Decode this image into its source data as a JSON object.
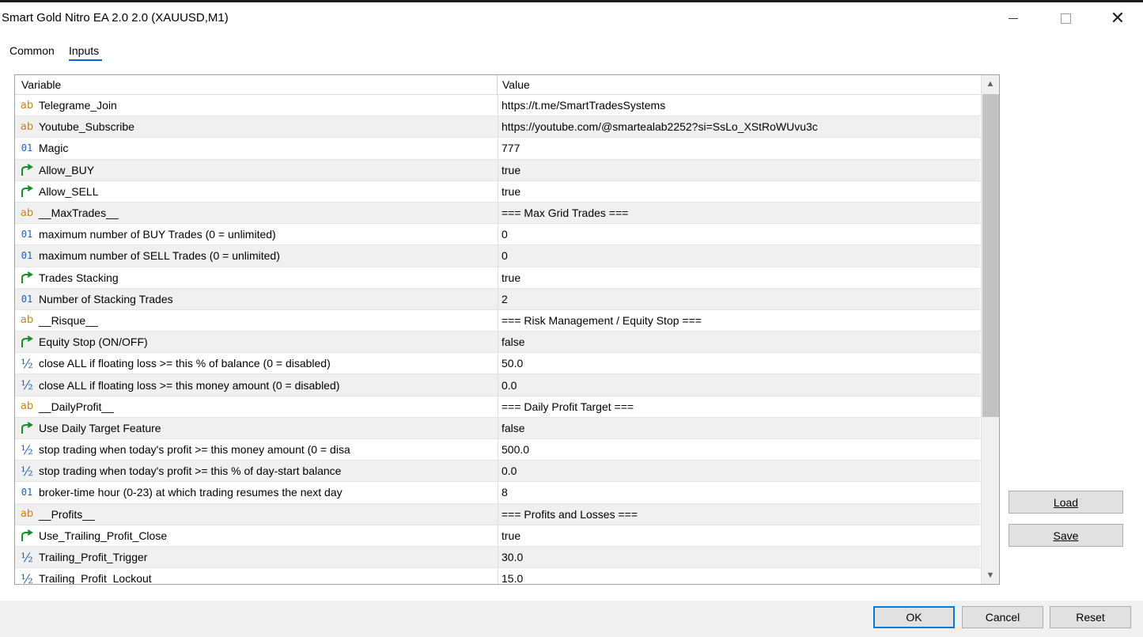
{
  "window": {
    "title": "Smart Gold Nitro EA 2.0 2.0 (XAUUSD,M1)"
  },
  "tabs": [
    {
      "label": "Common",
      "active": false
    },
    {
      "label": "Inputs",
      "active": true
    }
  ],
  "grid": {
    "headers": {
      "variable": "Variable",
      "value": "Value"
    },
    "rows": [
      {
        "type": "string",
        "icon_text": "ab",
        "variable": "Telegrame_Join",
        "value": "https://t.me/SmartTradesSystems"
      },
      {
        "type": "string",
        "icon_text": "ab",
        "variable": "Youtube_Subscribe",
        "value": "https://youtube.com/@smartealab2252?si=SsLo_XStRoWUvu3c"
      },
      {
        "type": "int",
        "icon_text": "01",
        "variable": "Magic",
        "value": "777"
      },
      {
        "type": "bool",
        "icon_text": "",
        "variable": "Allow_BUY",
        "value": "true"
      },
      {
        "type": "bool",
        "icon_text": "",
        "variable": "Allow_SELL",
        "value": "true"
      },
      {
        "type": "string",
        "icon_text": "ab",
        "variable": "__MaxTrades__",
        "value": "=== Max Grid Trades ==="
      },
      {
        "type": "int",
        "icon_text": "01",
        "variable": "maximum number of BUY Trades (0 = unlimited)",
        "value": "0"
      },
      {
        "type": "int",
        "icon_text": "01",
        "variable": "maximum number of SELL Trades  (0 = unlimited)",
        "value": "0"
      },
      {
        "type": "bool",
        "icon_text": "",
        "variable": "Trades Stacking",
        "value": "true"
      },
      {
        "type": "int",
        "icon_text": "01",
        "variable": "Number of Stacking Trades",
        "value": "2"
      },
      {
        "type": "string",
        "icon_text": "ab",
        "variable": "__Risque__",
        "value": "=== Risk Management / Equity Stop ==="
      },
      {
        "type": "bool",
        "icon_text": "",
        "variable": "Equity Stop (ON/OFF)",
        "value": "false"
      },
      {
        "type": "double",
        "icon_text": "½",
        "variable": "close ALL if floating loss >= this % of balance (0 = disabled)",
        "value": "50.0"
      },
      {
        "type": "double",
        "icon_text": "½",
        "variable": "close ALL  if floating loss >= this money amount (0 = disabled)",
        "value": "0.0"
      },
      {
        "type": "string",
        "icon_text": "ab",
        "variable": "__DailyProfit__",
        "value": "=== Daily Profit Target ==="
      },
      {
        "type": "bool",
        "icon_text": "",
        "variable": "Use Daily Target Feature",
        "value": "false"
      },
      {
        "type": "double",
        "icon_text": "½",
        "variable": "stop trading when today's profit >= this money amount (0 = disa",
        "value": "500.0"
      },
      {
        "type": "double",
        "icon_text": "½",
        "variable": "stop trading when today's profit >= this % of day-start balance",
        "value": "0.0"
      },
      {
        "type": "int",
        "icon_text": "01",
        "variable": "broker-time hour (0-23) at which trading resumes the next day",
        "value": "8"
      },
      {
        "type": "string",
        "icon_text": "ab",
        "variable": "__Profits__",
        "value": "=== Profits and Losses ==="
      },
      {
        "type": "bool",
        "icon_text": "",
        "variable": "Use_Trailing_Profit_Close",
        "value": "true"
      },
      {
        "type": "double",
        "icon_text": "½",
        "variable": "Trailing_Profit_Trigger",
        "value": "30.0"
      },
      {
        "type": "double",
        "icon_text": "½",
        "variable": "Trailing_Profit_Lockout",
        "value": "15.0"
      }
    ]
  },
  "side_buttons": {
    "load_label": "Load",
    "save_label": "Save"
  },
  "bottom_buttons": {
    "ok_label": "OK",
    "cancel_label": "Cancel",
    "reset_label": "Reset"
  },
  "colors": {
    "string_icon": "#c8860a",
    "numeric_icon": "#1f5fb0",
    "bool_icon": "#1a8a2a",
    "tab_accent": "#0a64d6",
    "default_button_border": "#0078d7"
  }
}
